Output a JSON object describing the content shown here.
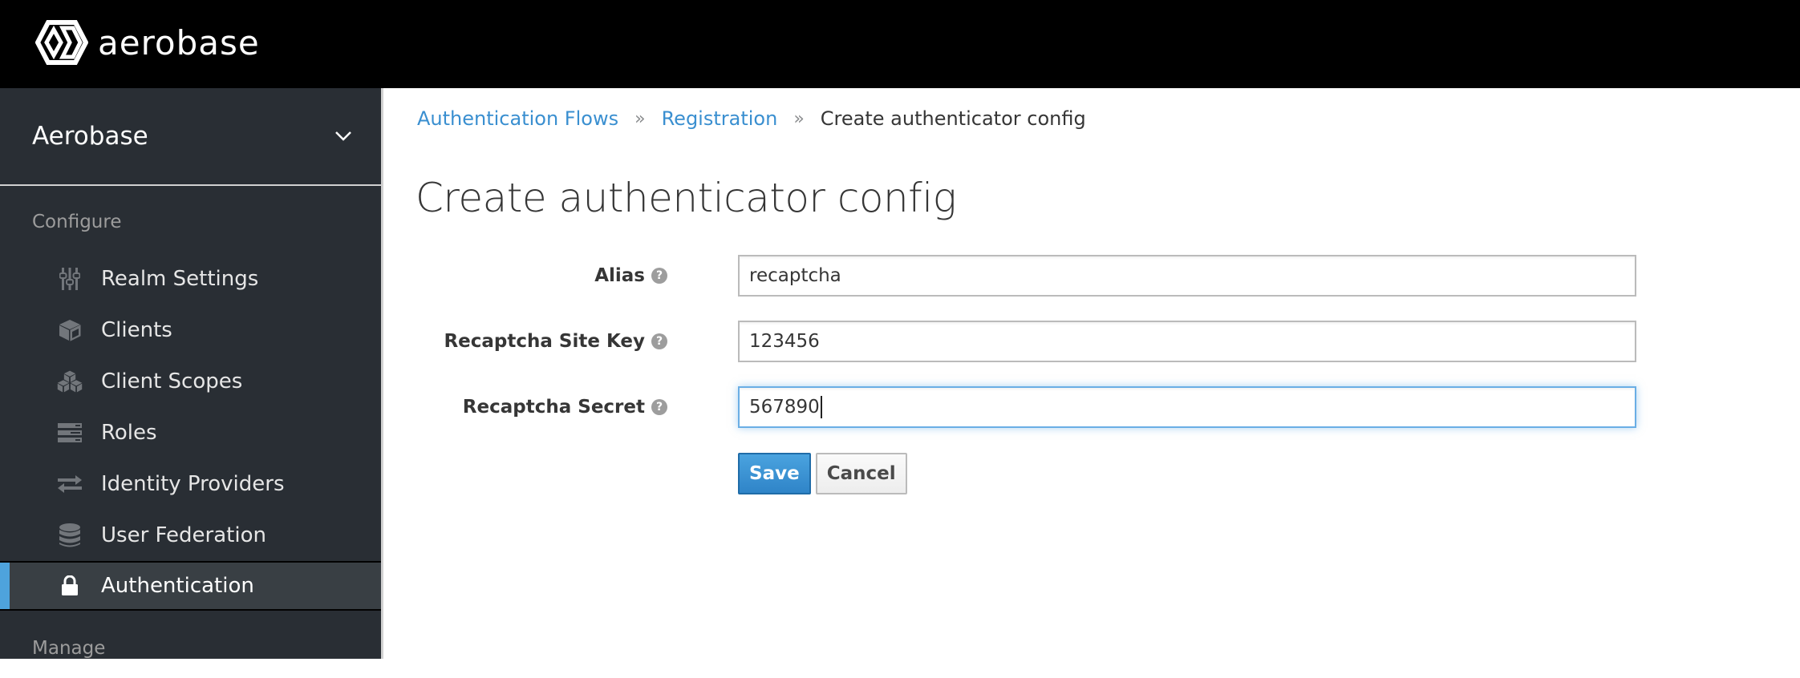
{
  "header": {
    "brand": "aerobase",
    "logo_icon": "aerobase-hexagon-logo"
  },
  "sidebar": {
    "realm": {
      "name": "Aerobase",
      "icon": "chevron-down-icon"
    },
    "sections": [
      {
        "title": "Configure",
        "items": [
          {
            "label": "Realm Settings",
            "icon": "sliders-icon",
            "active": false
          },
          {
            "label": "Clients",
            "icon": "cube-icon",
            "active": false
          },
          {
            "label": "Client Scopes",
            "icon": "cubes-icon",
            "active": false
          },
          {
            "label": "Roles",
            "icon": "server-stack-icon",
            "active": false
          },
          {
            "label": "Identity Providers",
            "icon": "exchange-arrows-icon",
            "active": false
          },
          {
            "label": "User Federation",
            "icon": "database-icon",
            "active": false
          },
          {
            "label": "Authentication",
            "icon": "lock-icon",
            "active": true
          }
        ]
      },
      {
        "title": "Manage",
        "items": []
      }
    ],
    "active_color": "#4ea3dc"
  },
  "breadcrumb": {
    "items": [
      {
        "label": "Authentication Flows",
        "link": true
      },
      {
        "label": "Registration",
        "link": true
      },
      {
        "label": "Create authenticator config",
        "link": false
      }
    ],
    "separator": "»"
  },
  "page": {
    "title": "Create authenticator config"
  },
  "form": {
    "fields": [
      {
        "label": "Alias",
        "value": "recaptcha",
        "help_icon": "question-circle-icon",
        "focused": false
      },
      {
        "label": "Recaptcha Site Key",
        "value": "123456",
        "help_icon": "question-circle-icon",
        "focused": false
      },
      {
        "label": "Recaptcha Secret",
        "value": "567890",
        "help_icon": "question-circle-icon",
        "focused": true
      }
    ],
    "help_glyph": "?",
    "save_label": "Save",
    "cancel_label": "Cancel"
  }
}
